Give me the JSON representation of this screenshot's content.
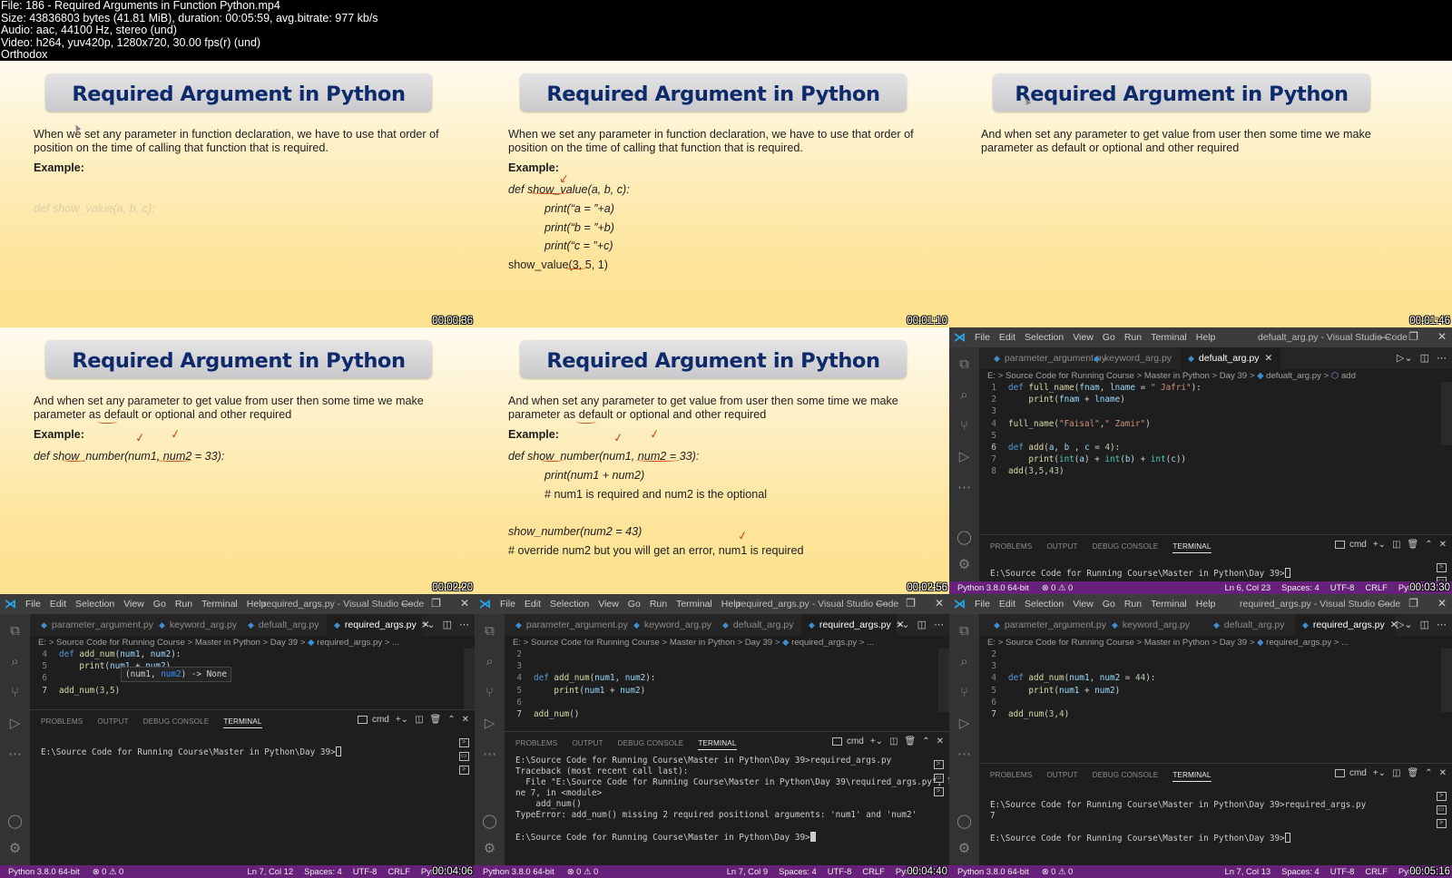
{
  "info": {
    "lines": [
      "File: 186 -  Required Arguments in Function Python.mp4",
      "Size: 43836803 bytes (41.81 MiB), duration: 00:05:59, avg.bitrate: 977 kb/s",
      "Audio: aac, 44100 Hz, stereo (und)",
      "Video: h264, yuv420p, 1280x720, 30.00 fps(r) (und)",
      "Orthodox"
    ]
  },
  "slides": [
    {
      "timestamp": "00:00:36",
      "title": "Required Argument in Python",
      "paragraph": "When we set any parameter in function declaration, we have to use that order of position on the time of calling that function that is required.",
      "example_label": "Example:",
      "faded_code": "def show_value(a, b, c):"
    },
    {
      "timestamp": "00:01:10",
      "title": "Required Argument in Python",
      "paragraph": "When we set any parameter in function declaration, we have to use that order of position on the time of calling that function that is required.",
      "example_label": "Example:",
      "code": [
        "def show_value(a, b, c):",
        "print(“a = ”+a)",
        "print(“b = ”+b)",
        "print(“c = ”+c)"
      ],
      "call": "show_value(3, 5, 1)"
    },
    {
      "timestamp": "00:01:46",
      "title": "Required Argument in Python",
      "paragraph": "And when set any parameter to get value from user then some time we make parameter as default or optional and other required"
    },
    {
      "timestamp": "00:02:20",
      "title": "Required Argument in Python",
      "paragraph": "And when set any parameter to get value from user then some time we make parameter as default or optional and other required",
      "example_label": "Example:",
      "code": [
        "def show_number(num1, num2 = 33):"
      ]
    },
    {
      "timestamp": "00:02:56",
      "title": "Required Argument in Python",
      "paragraph": "And when set any parameter to get value from user then some time we make parameter as default or optional and other required",
      "example_label": "Example:",
      "code": [
        "def show_number(num1, num2 = 33):",
        "print(num1 + num2)",
        "# num1 is required and num2 is the optional"
      ],
      "call": "show_number(num2 = 43)",
      "call_comment": "# override num2 but you will get an error, num1 is required"
    }
  ],
  "vscode_common": {
    "menu": [
      "File",
      "Edit",
      "Selection",
      "View",
      "Go",
      "Run",
      "Terminal",
      "Help"
    ],
    "tabs": [
      "parameter_argument.py",
      "keyword_arg.py",
      "defualt_arg.py",
      "required_args.py"
    ],
    "panel_tabs": [
      "PROBLEMS",
      "OUTPUT",
      "DEBUG CONSOLE",
      "TERMINAL"
    ],
    "shell": "cmd",
    "status_left": "Python 3.8.0 64-bit",
    "status_problems": "⊗ 0 ⚠ 0",
    "spaces": "Spaces: 4",
    "encoding": "UTF-8",
    "eol": "CRLF",
    "language": "Python",
    "icons": {
      "explorer": "files-icon",
      "search": "search-icon",
      "scm": "source-control-icon",
      "debug": "run-debug-icon",
      "more": "ellipsis-icon",
      "account": "account-icon",
      "settings": "gear-icon"
    }
  },
  "vscode_frames": [
    {
      "timestamp": "00:03:30",
      "window_title": "defualt_arg.py - Visual Studio Code",
      "active_tab": "defualt_arg.py",
      "breadcrumb": [
        "E:",
        "Source Code for Running Course",
        "Master in Python",
        "Day 39",
        "defualt_arg.py",
        "add"
      ],
      "lines": [
        {
          "n": "1",
          "code": "def full_name(fnam, lname = \" Jafri\"):"
        },
        {
          "n": "2",
          "code": "    print(fnam + lname)"
        },
        {
          "n": "3",
          "code": ""
        },
        {
          "n": "4",
          "code": "full_name(\"Faisal\",\" Zamir\")"
        },
        {
          "n": "5",
          "code": ""
        },
        {
          "n": "6",
          "code": "def add(a, b , c = 4):"
        },
        {
          "n": "7",
          "code": "    print(int(a) + int(b) + int(c))"
        },
        {
          "n": "8",
          "code": "add(3,5,43)"
        }
      ],
      "terminal": [
        "E:\\Source Code for Running Course\\Master in Python\\Day 39>"
      ],
      "cursor_pos": "Ln 6, Col 23"
    },
    {
      "timestamp": "00:04:06",
      "window_title": "required_args.py - Visual Studio Code",
      "active_tab": "required_args.py",
      "breadcrumb": [
        "E:",
        "Source Code for Running Course",
        "Master in Python",
        "Day 39",
        "required_args.py",
        "..."
      ],
      "lines": [
        {
          "n": "4",
          "code": "def add_num(num1, num2):"
        },
        {
          "n": "5",
          "code": "    print(num1 + num2)"
        },
        {
          "n": "6",
          "code": ""
        },
        {
          "n": "7",
          "code": "add_num(3,5)"
        }
      ],
      "hint": {
        "before": "(num1, ",
        "highlight": "num2",
        "after": ") -> None"
      },
      "terminal": [
        "E:\\Source Code for Running Course\\Master in Python\\Day 39>"
      ],
      "cursor_pos": "Ln 7, Col 12"
    },
    {
      "timestamp": "00:04:40",
      "window_title": "required_args.py - Visual Studio Code",
      "active_tab": "required_args.py",
      "breadcrumb": [
        "E:",
        "Source Code for Running Course",
        "Master in Python",
        "Day 39",
        "required_args.py",
        "..."
      ],
      "lines": [
        {
          "n": "2",
          "code": ""
        },
        {
          "n": "3",
          "code": ""
        },
        {
          "n": "4",
          "code": "def add_num(num1, num2):"
        },
        {
          "n": "5",
          "code": "    print(num1 + num2)"
        },
        {
          "n": "6",
          "code": ""
        },
        {
          "n": "7",
          "code": "add_num()"
        }
      ],
      "terminal": [
        "E:\\Source Code for Running Course\\Master in Python\\Day 39>required_args.py",
        "Traceback (most recent call last):",
        "  File \"E:\\Source Code for Running Course\\Master in Python\\Day 39\\required_args.py\", li",
        "ne 7, in <module>",
        "    add_num()",
        "TypeError: add_num() missing 2 required positional arguments: 'num1' and 'num2'",
        "",
        "E:\\Source Code for Running Course\\Master in Python\\Day 39>"
      ],
      "cursor_pos": "Ln 7, Col 9"
    },
    {
      "timestamp": "00:05:16",
      "window_title": "required_args.py - Visual Studio Code",
      "active_tab": "required_args.py",
      "breadcrumb": [
        "E:",
        "Source Code for Running Course",
        "Master in Python",
        "Day 39",
        "required_args.py",
        "..."
      ],
      "lines": [
        {
          "n": "2",
          "code": ""
        },
        {
          "n": "3",
          "code": ""
        },
        {
          "n": "4",
          "code": "def add_num(num1, num2 = 44):"
        },
        {
          "n": "5",
          "code": "    print(num1 + num2)"
        },
        {
          "n": "6",
          "code": ""
        },
        {
          "n": "7",
          "code": "add_num(3,4)"
        }
      ],
      "terminal": [
        "E:\\Source Code for Running Course\\Master in Python\\Day 39>required_args.py",
        "7",
        "",
        "E:\\Source Code for Running Course\\Master in Python\\Day 39>"
      ],
      "cursor_pos": "Ln 7, Col 13"
    }
  ]
}
